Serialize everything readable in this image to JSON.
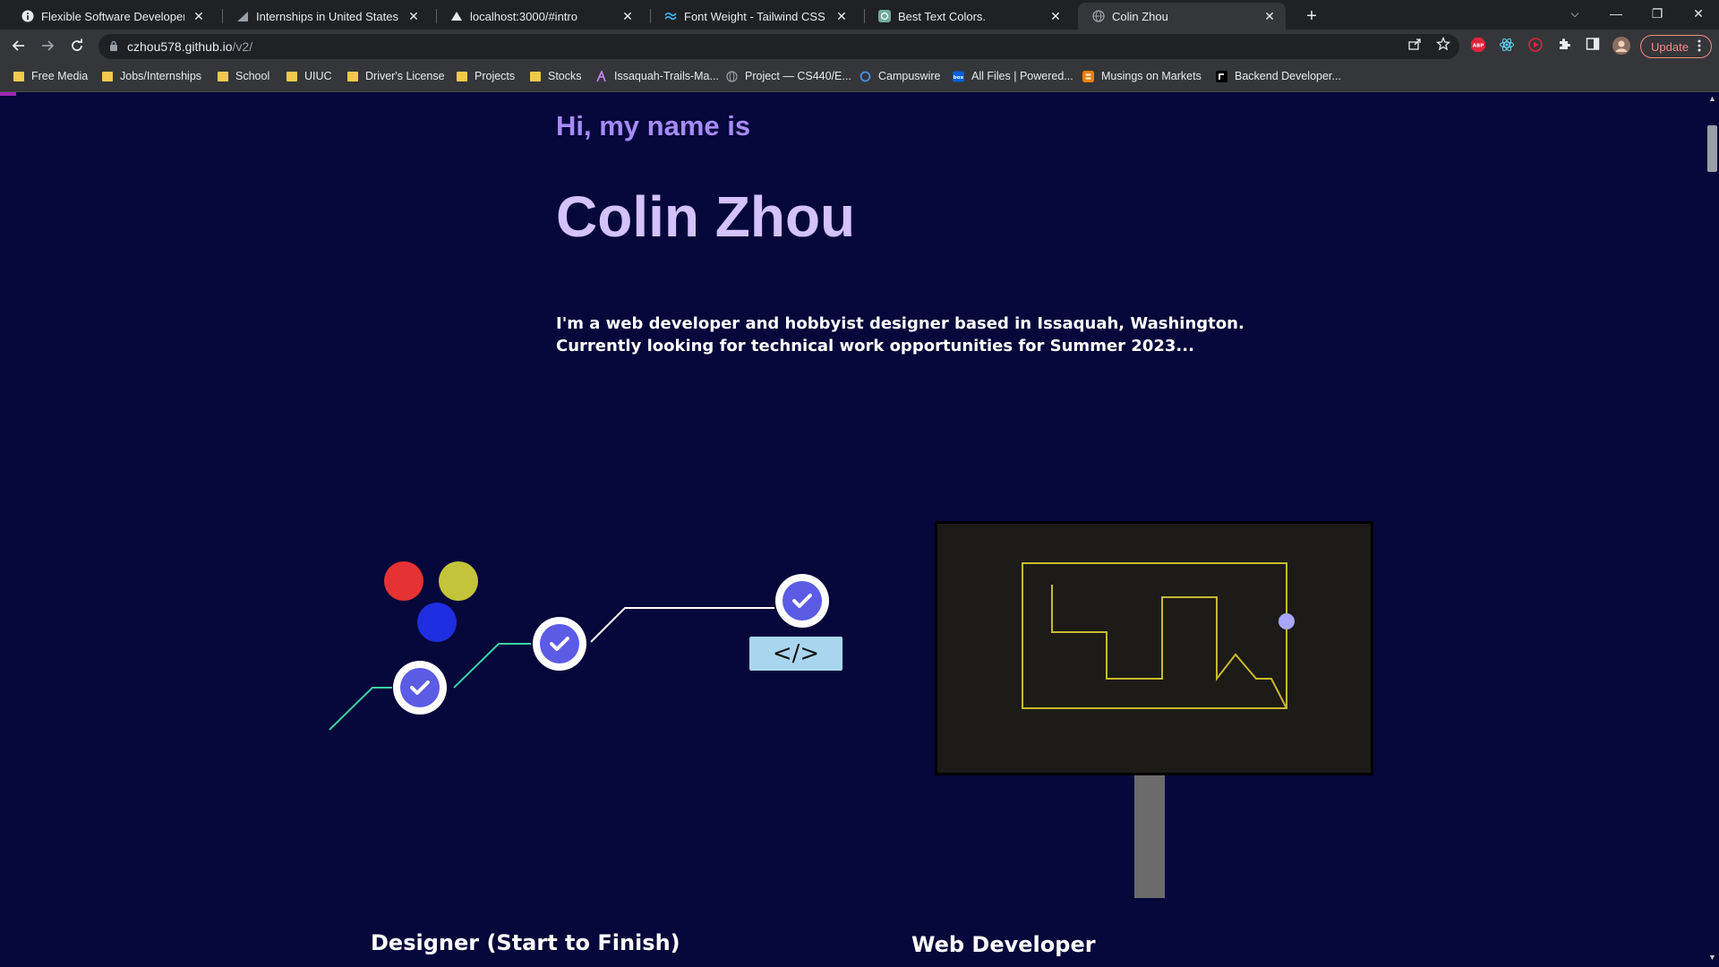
{
  "browser": {
    "tabs": [
      {
        "title": "Flexible Software Developer Inter",
        "icon": "info-icon"
      },
      {
        "title": "Internships in United States | Lev",
        "icon": "levels-icon"
      },
      {
        "title": "localhost:3000/#intro",
        "icon": "triangle-icon"
      },
      {
        "title": "Font Weight - Tailwind CSS",
        "icon": "tailwind-icon"
      },
      {
        "title": "Best Text Colors.",
        "icon": "openai-icon"
      },
      {
        "title": "Colin Zhou",
        "icon": "globe-icon",
        "active": true
      }
    ],
    "close_glyph": "✕",
    "new_tab_glyph": "+",
    "window_controls": {
      "dropdown": "⌵",
      "minimize": "—",
      "restore": "❐",
      "close": "✕"
    },
    "url": {
      "host": "czhou578.github.io",
      "path": "/v2/"
    },
    "update_label": "Update",
    "bookmarks": [
      {
        "label": "Free Media",
        "type": "folder"
      },
      {
        "label": "Jobs/Internships",
        "type": "folder"
      },
      {
        "label": "School",
        "type": "folder"
      },
      {
        "label": "UIUC",
        "type": "folder"
      },
      {
        "label": "Driver's License",
        "type": "folder"
      },
      {
        "label": "Projects",
        "type": "folder"
      },
      {
        "label": "Stocks",
        "type": "folder"
      },
      {
        "label": "Issaquah-Trails-Ma...",
        "type": "link",
        "icon": "vercel-icon"
      },
      {
        "label": "Project — CS440/E...",
        "type": "link",
        "icon": "globe-icon"
      },
      {
        "label": "Campuswire",
        "type": "link",
        "icon": "campuswire-icon"
      },
      {
        "label": "All Files | Powered...",
        "type": "link",
        "icon": "box-icon"
      },
      {
        "label": "Musings on Markets",
        "type": "link",
        "icon": "blogger-icon"
      },
      {
        "label": "Backend Developer...",
        "type": "link",
        "icon": "roadmap-icon"
      }
    ]
  },
  "page": {
    "greeting": "Hi, my name is",
    "name": "Colin Zhou",
    "bio_line1": "I'm a web developer and hobbyist designer based in Issaquah, Washington.",
    "bio_line2": "Currently looking for technical work opportunities for Summer 2023...",
    "designer_title": "Designer (Start to Finish)",
    "developer_title": "Web Developer",
    "code_tag": "</>",
    "colors": {
      "background": "#06073a",
      "greeting": "#a78bfa",
      "name": "#d3c2fb",
      "dot_red": "#e63232",
      "dot_yellow": "#c3c43a",
      "dot_blue": "#1e2ee0",
      "check_fill": "#5b5be6",
      "path_line": "#39d3a8",
      "code_box": "#a9d6ee",
      "monitor_line": "#c9b92c",
      "monitor_dot": "#a9a6ff"
    }
  }
}
